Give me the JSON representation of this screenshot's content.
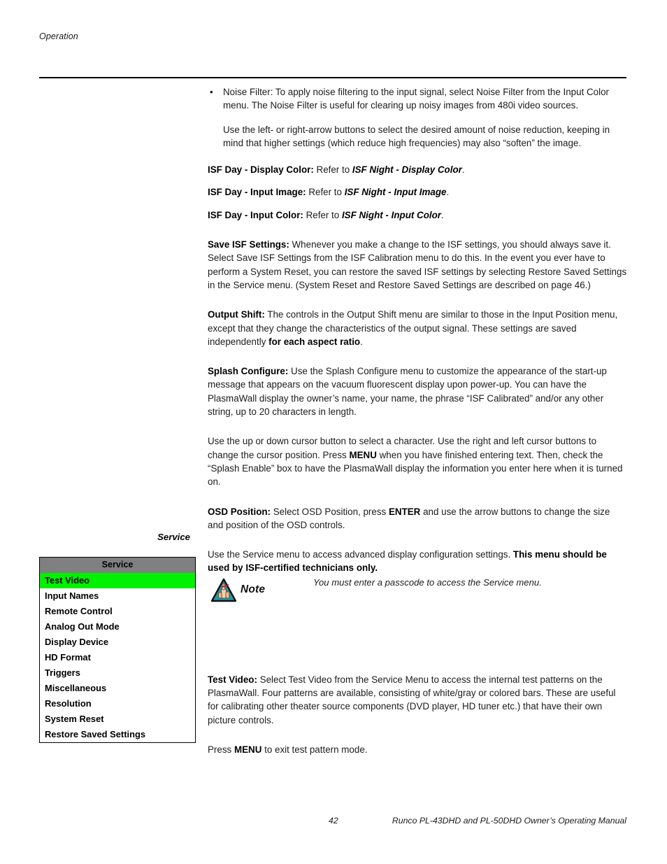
{
  "header": {
    "running_head": "Operation"
  },
  "body": {
    "bullet_noise_filter": {
      "bullet_char": "•",
      "term": "Noise Filter:",
      "text": " To apply noise filtering to the input signal, select Noise Filter from the Input Color menu. The Noise Filter is useful for clearing up noisy images from 480i video sources."
    },
    "noise_filter_sub": "Use the left- or right-arrow buttons to select the desired amount of noise reduction, keeping in mind that higher settings (which reduce high frequencies) may also “soften” the image.",
    "isf_day_display_color": {
      "term": "ISF Day - Display Color:",
      "mid": " Refer to ",
      "ref": "ISF Night - Display Color",
      "end": "."
    },
    "isf_day_input_image": {
      "term": "ISF Day - Input Image:",
      "mid": " Refer to ",
      "ref": "ISF Night - Input Image",
      "end": "."
    },
    "isf_day_input_color": {
      "term": "ISF Day - Input Color:",
      "mid": " Refer to ",
      "ref": "ISF Night - Input Color",
      "end": "."
    },
    "save_isf_settings": {
      "term": "Save ISF Settings:",
      "text": " Whenever you make a change to the ISF settings, you should always save it. Select Save ISF Settings from the ISF Calibration menu to do this. In the event you ever have to perform a System Reset, you can restore the saved ISF settings by selecting Restore Saved Settings in the Service menu. (System Reset and Restore Saved Settings are described on page 46.)"
    },
    "output_shift": {
      "term": "Output Shift:",
      "text_a": " The controls in the Output Shift menu are similar to those in the Input Position menu, except that they change the characteristics of the output signal. These settings are saved independently ",
      "bold_b": "for each aspect ratio",
      "text_c": "."
    },
    "splash_configure": {
      "term": "Splash Configure:",
      "text": " Use the Splash Configure menu to customize the appearance of the start-up message that appears on the vacuum fluorescent display upon power-up. You can have the PlasmaWall display the owner’s name, your name, the phrase “ISF Calibrated” and/or any other string, up to 20 characters in length."
    },
    "splash_instructions": {
      "text_a": "Use the up or down cursor button to select a character. Use the right and left cursor buttons to change the cursor position. Press ",
      "bold_b": "MENU",
      "text_c": " when you have finished entering text. Then, check the “Splash Enable” box to have the PlasmaWall display the information you enter here when it is turned on."
    },
    "osd_position": {
      "term": "OSD Position:",
      "text_a": " Select OSD Position, press ",
      "bold_b": "ENTER",
      "text_c": " and use the arrow buttons to change the size and position of the OSD controls."
    },
    "service_intro": {
      "text_a": "Use the Service menu to access advanced display configuration settings. ",
      "bold_b": "This menu should be used by ISF-certified technicians only."
    },
    "test_video": {
      "term": "Test Video:",
      "text": " Select Test Video from the Service Menu to access the internal test patterns on the PlasmaWall. Four patterns are available, consisting of white/gray or colored bars. These are useful for calibrating other theater source components (DVD player, HD tuner etc.) that have their own picture controls."
    },
    "exit_test_pattern": {
      "text_a": "Press ",
      "bold_b": "MENU",
      "text_c": " to exit test pattern mode."
    }
  },
  "side_head": {
    "label": "Service"
  },
  "osd_menu": {
    "title": "Service",
    "header_color": "#808080",
    "selected_color": "#00f200",
    "items": [
      {
        "label": "Test Video",
        "selected": true
      },
      {
        "label": "Input Names",
        "selected": false
      },
      {
        "label": "Remote Control",
        "selected": false
      },
      {
        "label": "Analog Out Mode",
        "selected": false
      },
      {
        "label": "Display Device",
        "selected": false
      },
      {
        "label": "HD Format",
        "selected": false
      },
      {
        "label": "Triggers",
        "selected": false
      },
      {
        "label": "Miscellaneous",
        "selected": false
      },
      {
        "label": "Resolution",
        "selected": false
      },
      {
        "label": "System Reset",
        "selected": false
      },
      {
        "label": "Restore Saved Settings",
        "selected": false
      }
    ]
  },
  "note": {
    "icon_name": "note-triangle-icon",
    "label": "Note",
    "text": "You must enter a passcode to access the Service menu.",
    "triangle_color": "#2596a8",
    "accent_color": "#cc2222"
  },
  "footer": {
    "page_number": "42",
    "manual_title": "Runco PL-43DHD and PL-50DHD Owner’s Operating Manual"
  }
}
